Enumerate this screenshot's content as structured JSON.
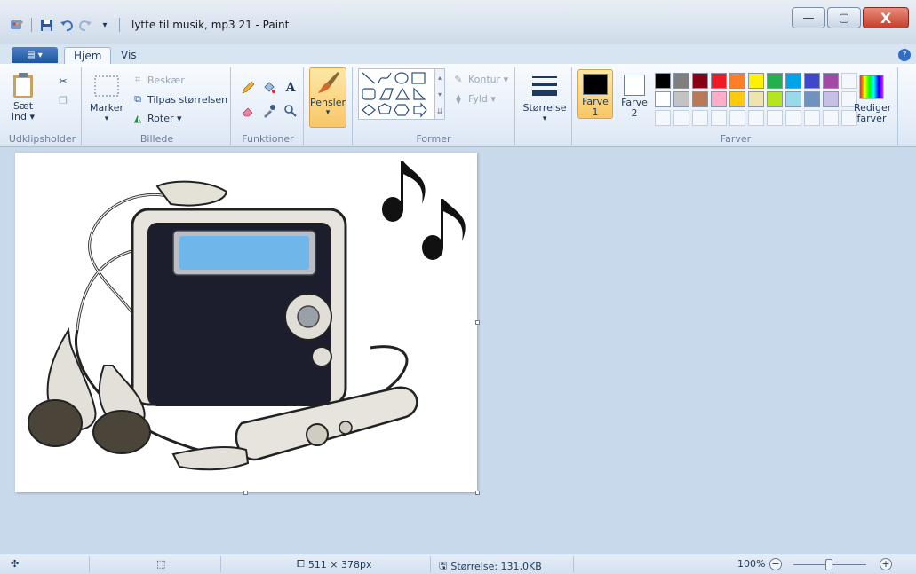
{
  "window": {
    "title": "lytte til musik, mp3 21 - Paint",
    "minimize_symbol": "—",
    "maximize_symbol": "▢",
    "close_symbol": "X"
  },
  "tabs": [
    {
      "label": "Hjem",
      "active": true
    },
    {
      "label": "Vis",
      "active": false
    }
  ],
  "app_menu_label": "▤ ▾",
  "help_symbol": "?",
  "ribbon": {
    "clipboard": {
      "group_label": "Udklipsholder",
      "paste_label": "Sæt ind ▾"
    },
    "image": {
      "group_label": "Billede",
      "select_label": "Marker",
      "crop_label": "Beskær",
      "resize_label": "Tilpas størrelsen",
      "rotate_label": "Roter ▾"
    },
    "tools": {
      "group_label": "Funktioner",
      "text_tool": "A"
    },
    "brushes": {
      "label": "Pensler",
      "dropdown": "▾"
    },
    "shapes": {
      "group_label": "Former",
      "outline_label": "Kontur ▾",
      "fill_label": "Fyld ▾"
    },
    "size": {
      "label": "Størrelse",
      "dropdown": "▾"
    },
    "colors": {
      "group_label": "Farver",
      "color1_label": "Farve 1",
      "color2_label": "Farve 2",
      "color1_value": "#000000",
      "color2_value": "#ffffff",
      "edit_label": "Rediger farver",
      "palette": [
        "#000000",
        "#7f7f7f",
        "#880015",
        "#ed1c24",
        "#ff7f27",
        "#fff200",
        "#22b14c",
        "#00a2e8",
        "#3f48cc",
        "#a349a4",
        "#ffffff",
        "#c3c3c3",
        "#b97a57",
        "#ffaec9",
        "#ffc90e",
        "#efe4b0",
        "#b5e61d",
        "#99d9ea",
        "#7092be",
        "#c8bfe7"
      ]
    }
  },
  "statusbar": {
    "dimensions": "511 × 378px",
    "filesize": "Størrelse: 131,0KB",
    "zoom": "100%",
    "zoom_minus": "−",
    "zoom_plus": "+"
  }
}
